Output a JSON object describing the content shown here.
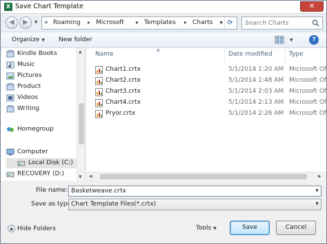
{
  "window": {
    "title": "Save Chart Template",
    "app_icon_letter": "X",
    "close_symbol": "✕"
  },
  "nav": {
    "breadcrumb": [
      "«",
      "Roaming",
      "Microsoft",
      "Templates",
      "Charts"
    ],
    "search_placeholder": "Search Charts"
  },
  "toolbar": {
    "organize_label": "Organize",
    "new_folder_label": "New folder",
    "help_label": "?"
  },
  "sidebar": {
    "items": [
      {
        "label": "Kindle Books",
        "icon": "library-icon"
      },
      {
        "label": "Music",
        "icon": "music-icon"
      },
      {
        "label": "Pictures",
        "icon": "pictures-icon"
      },
      {
        "label": "Product",
        "icon": "library-icon"
      },
      {
        "label": "Videos",
        "icon": "video-icon"
      },
      {
        "label": "Writing",
        "icon": "writing-icon"
      },
      {
        "label": "Homegroup",
        "icon": "homegroup-icon"
      },
      {
        "label": "Computer",
        "icon": "computer-icon"
      },
      {
        "label": "Local Disk (C:)",
        "icon": "drive-icon"
      },
      {
        "label": "RECOVERY (D:)",
        "icon": "drive-icon"
      }
    ]
  },
  "files": {
    "columns": [
      "Name",
      "Date modified",
      "Type"
    ],
    "rows": [
      {
        "name": "Chart1.crtx",
        "date": "5/1/2014 1:20 AM",
        "type": "Microsoft Of"
      },
      {
        "name": "Chart2.crtx",
        "date": "5/1/2014 1:48 AM",
        "type": "Microsoft Of"
      },
      {
        "name": "Chart3.crtx",
        "date": "5/1/2014 2:03 AM",
        "type": "Microsoft Of"
      },
      {
        "name": "Chart4.crtx",
        "date": "5/1/2014 2:13 AM",
        "type": "Microsoft Of"
      },
      {
        "name": "Pryor.crtx",
        "date": "5/1/2014 2:26 AM",
        "type": "Microsoft Of"
      }
    ]
  },
  "form": {
    "file_name_label": "File name:",
    "file_name_value": "Basketweave.crtx",
    "save_as_type_label": "Save as type:",
    "save_as_type_value": "Chart Template Files(*.crtx)"
  },
  "footer": {
    "hide_folders_label": "Hide Folders",
    "tools_label": "Tools",
    "save_label": "Save",
    "cancel_label": "Cancel"
  },
  "colors": {
    "accent": "#3c7fb1",
    "excel_green": "#1f7244",
    "close_red": "#c7443a"
  }
}
